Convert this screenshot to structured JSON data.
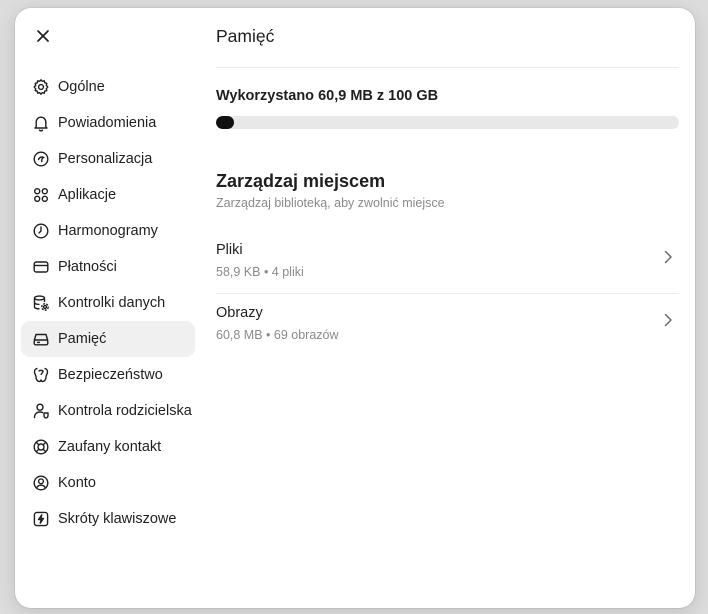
{
  "colors": {
    "accent": "#111111",
    "track": "#e8e8e8",
    "muted_text": "#8a8a8a",
    "active_bg": "#f0f0f0"
  },
  "close_icon": "close-icon",
  "sidebar": {
    "items": [
      {
        "label": "Ogólne",
        "icon": "gear-icon"
      },
      {
        "label": "Powiadomienia",
        "icon": "bell-icon"
      },
      {
        "label": "Personalizacja",
        "icon": "palette-icon"
      },
      {
        "label": "Aplikacje",
        "icon": "apps-grid-icon"
      },
      {
        "label": "Harmonogramy",
        "icon": "clock-icon"
      },
      {
        "label": "Płatności",
        "icon": "card-icon"
      },
      {
        "label": "Kontrolki danych",
        "icon": "database-gear-icon"
      },
      {
        "label": "Pamięć",
        "icon": "storage-icon",
        "active": true
      },
      {
        "label": "Bezpieczeństwo",
        "icon": "security-icon"
      },
      {
        "label": "Kontrola rodzicielska",
        "icon": "parental-icon"
      },
      {
        "label": "Zaufany kontakt",
        "icon": "lifebuoy-icon"
      },
      {
        "label": "Konto",
        "icon": "user-circle-icon"
      },
      {
        "label": "Skróty klawiszowe",
        "icon": "shortcut-icon"
      }
    ]
  },
  "main": {
    "title": "Pamięć",
    "usage": {
      "label": "Wykorzystano 60,9 MB z 100 GB",
      "fraction": 0.0006
    },
    "manage": {
      "title": "Zarządzaj miejscem",
      "subtitle": "Zarządzaj biblioteką, aby zwolnić miejsce",
      "rows": [
        {
          "title": "Pliki",
          "meta": "58,9 KB • 4 pliki"
        },
        {
          "title": "Obrazy",
          "meta": "60,8 MB • 69 obrazów"
        }
      ]
    }
  }
}
